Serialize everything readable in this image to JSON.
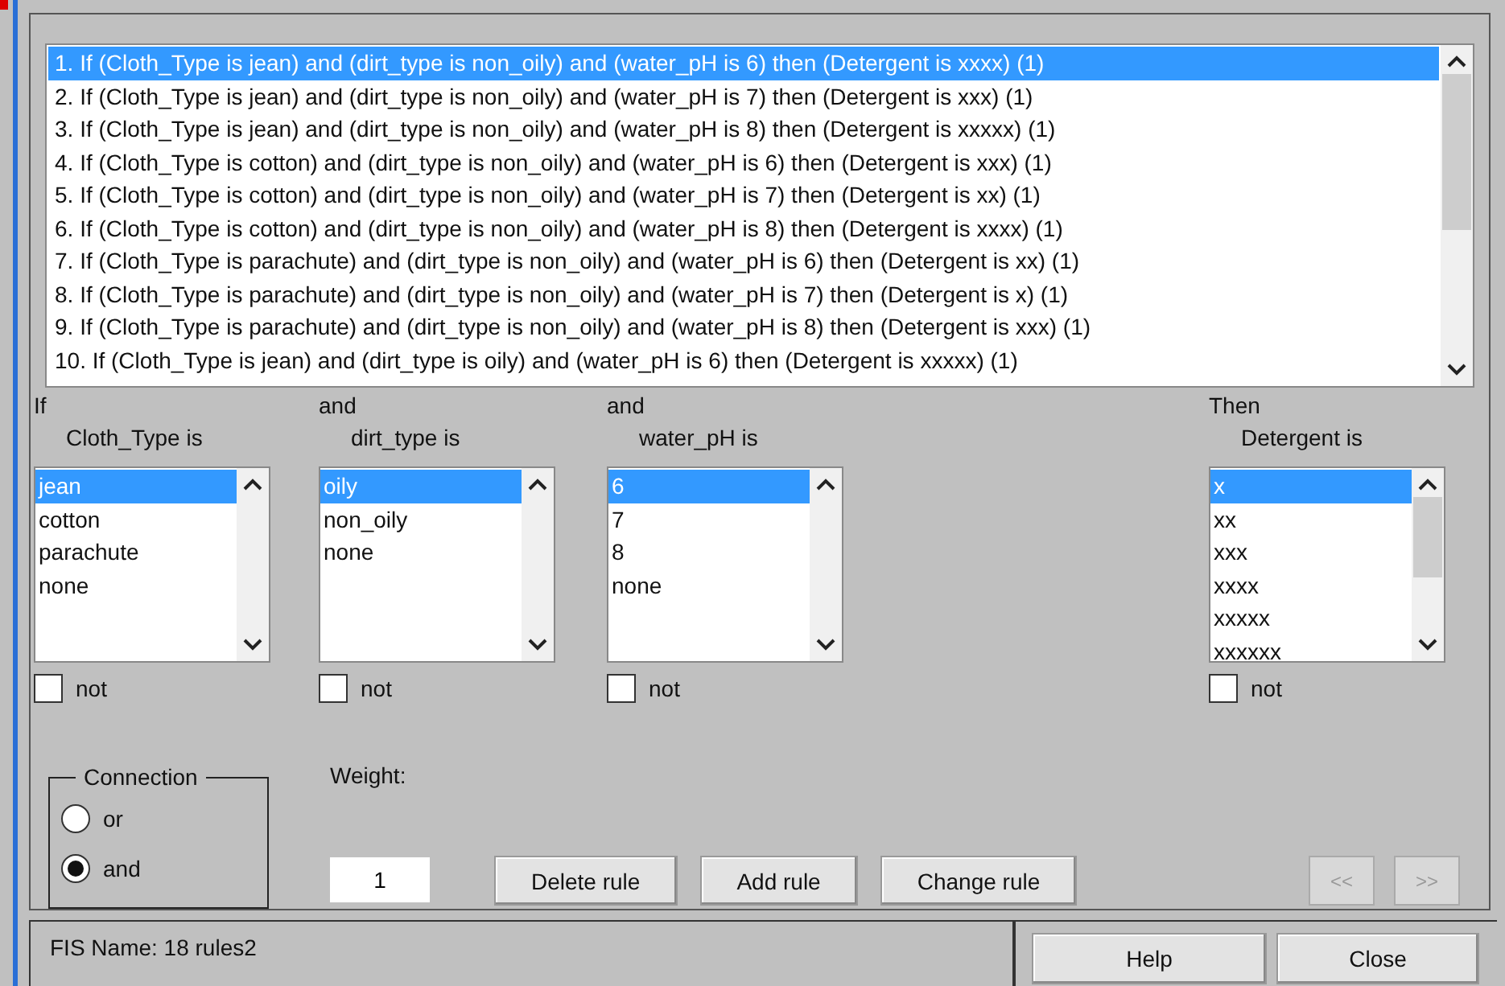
{
  "rules": [
    {
      "text": "1. If (Cloth_Type is jean) and (dirt_type is non_oily) and (water_pH is 6) then (Detergent is xxxx) (1)",
      "selected": true
    },
    {
      "text": "2. If (Cloth_Type is jean) and (dirt_type is non_oily) and (water_pH is 7) then (Detergent is xxx) (1)",
      "selected": false
    },
    {
      "text": "3. If (Cloth_Type is jean) and (dirt_type is non_oily) and (water_pH is 8) then (Detergent is xxxxx) (1)",
      "selected": false
    },
    {
      "text": "4. If (Cloth_Type is cotton) and (dirt_type is non_oily) and (water_pH is 6) then (Detergent is xxx) (1)",
      "selected": false
    },
    {
      "text": "5. If (Cloth_Type is cotton) and (dirt_type is non_oily) and (water_pH is 7) then (Detergent is xx) (1)",
      "selected": false
    },
    {
      "text": "6. If (Cloth_Type is cotton) and (dirt_type is non_oily) and (water_pH is 8) then (Detergent is xxxx) (1)",
      "selected": false
    },
    {
      "text": "7. If (Cloth_Type is parachute) and (dirt_type is non_oily) and (water_pH is 6) then (Detergent is xx) (1)",
      "selected": false
    },
    {
      "text": "8. If (Cloth_Type is parachute) and (dirt_type is non_oily) and (water_pH is 7) then (Detergent is x) (1)",
      "selected": false
    },
    {
      "text": "9. If (Cloth_Type is parachute) and (dirt_type is non_oily) and (water_pH is 8) then (Detergent is xxx) (1)",
      "selected": false
    },
    {
      "text": "10. If (Cloth_Type is jean) and (dirt_type is oily) and (water_pH is 6) then (Detergent is xxxxx) (1)",
      "selected": false
    }
  ],
  "selectors": [
    {
      "connector": "If",
      "variable": "Cloth_Type is",
      "items": [
        {
          "label": "jean",
          "selected": true
        },
        {
          "label": "cotton",
          "selected": false
        },
        {
          "label": "parachute",
          "selected": false
        },
        {
          "label": "none",
          "selected": false
        }
      ],
      "not_label": "not",
      "not_checked": false
    },
    {
      "connector": "and",
      "variable": "dirt_type is",
      "items": [
        {
          "label": "oily",
          "selected": true
        },
        {
          "label": "non_oily",
          "selected": false
        },
        {
          "label": "none",
          "selected": false
        }
      ],
      "not_label": "not",
      "not_checked": false
    },
    {
      "connector": "and",
      "variable": "water_pH is",
      "items": [
        {
          "label": "6",
          "selected": true
        },
        {
          "label": "7",
          "selected": false
        },
        {
          "label": "8",
          "selected": false
        },
        {
          "label": "none",
          "selected": false
        }
      ],
      "not_label": "not",
      "not_checked": false
    },
    {
      "connector": "Then",
      "variable": "Detergent is",
      "items": [
        {
          "label": "x",
          "selected": true
        },
        {
          "label": "xx",
          "selected": false
        },
        {
          "label": "xxx",
          "selected": false
        },
        {
          "label": "xxxx",
          "selected": false
        },
        {
          "label": "xxxxx",
          "selected": false
        },
        {
          "label": "xxxxxx",
          "selected": false
        }
      ],
      "not_label": "not",
      "not_checked": false
    }
  ],
  "connection": {
    "title": "Connection",
    "options": [
      {
        "label": "or",
        "selected": false
      },
      {
        "label": "and",
        "selected": true
      }
    ]
  },
  "weight": {
    "label": "Weight:",
    "value": "1"
  },
  "rule_buttons": [
    {
      "label": "Delete rule",
      "disabled": false
    },
    {
      "label": "Add rule",
      "disabled": false
    },
    {
      "label": "Change rule",
      "disabled": false
    }
  ],
  "nav_buttons": [
    {
      "label": "<<",
      "disabled": true
    },
    {
      "label": ">>",
      "disabled": true
    }
  ],
  "status": "FIS Name: 18 rules2",
  "footer_buttons": [
    {
      "label": "Help"
    },
    {
      "label": "Close"
    }
  ]
}
